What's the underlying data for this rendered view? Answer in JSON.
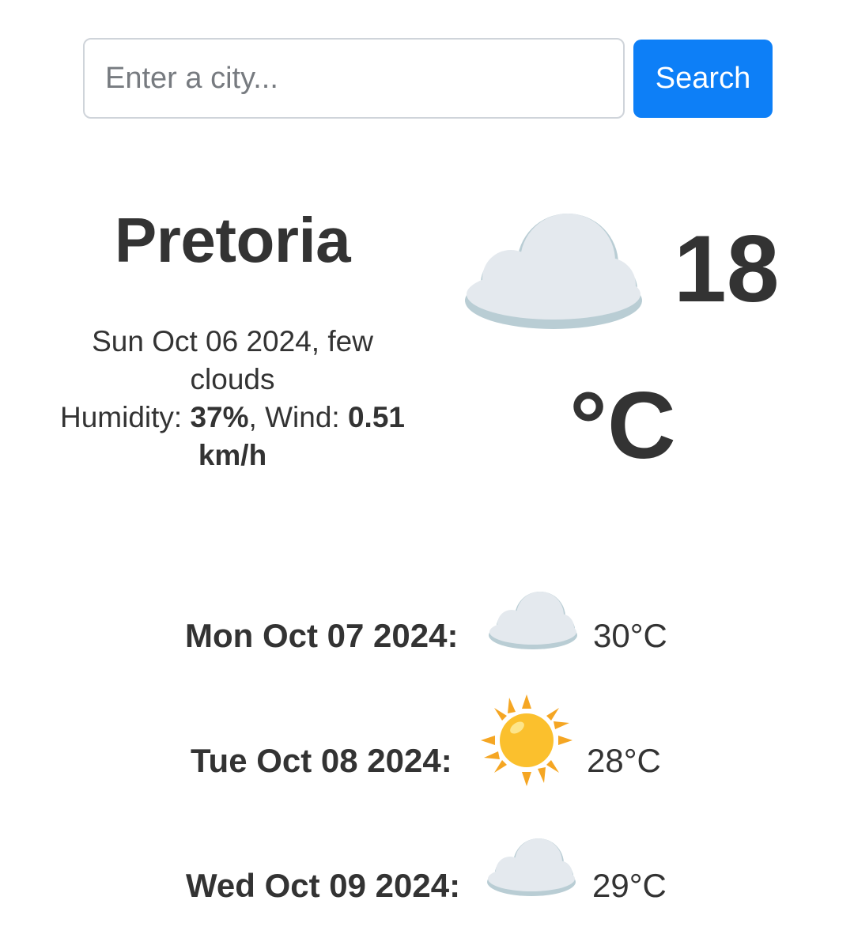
{
  "search": {
    "placeholder": "Enter a city...",
    "button_label": "Search"
  },
  "current": {
    "city": "Pretoria",
    "date_desc": "Sun Oct 06 2024, few clouds",
    "humidity_label": "Humidity: ",
    "humidity_value": "37%",
    "wind_label": ", Wind: ",
    "wind_value": "0.51 km/h",
    "icon": "cloud-icon",
    "temperature": "18",
    "unit": "°C"
  },
  "forecast": [
    {
      "date": "Mon Oct 07 2024:",
      "icon": "cloud-icon",
      "temp": "30°C"
    },
    {
      "date": "Tue Oct 08 2024:",
      "icon": "sun-icon",
      "temp": "28°C"
    },
    {
      "date": "Wed Oct 09 2024:",
      "icon": "cloud-icon",
      "temp": "29°C"
    }
  ],
  "colors": {
    "accent": "#0d7ff7",
    "text": "#333333",
    "cloud_light": "#e4e9ee",
    "cloud_shadow": "#b9cdd4",
    "sun": "#fbc02d",
    "sun_rays": "#f5a623"
  }
}
